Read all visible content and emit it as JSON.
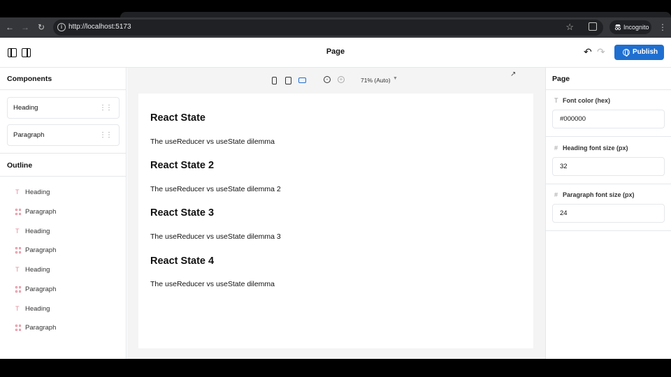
{
  "browser": {
    "url": "http://localhost:5173",
    "profile_label": "Incognito"
  },
  "app": {
    "page_title": "Page",
    "publish_label": "Publish"
  },
  "left_panel": {
    "components_title": "Components",
    "components": [
      {
        "label": "Heading"
      },
      {
        "label": "Paragraph"
      }
    ],
    "outline_title": "Outline",
    "outline": [
      {
        "label": "Heading",
        "icon": "text-icon"
      },
      {
        "label": "Paragraph",
        "icon": "grid-icon"
      },
      {
        "label": "Heading",
        "icon": "text-icon"
      },
      {
        "label": "Paragraph",
        "icon": "grid-icon"
      },
      {
        "label": "Heading",
        "icon": "text-icon"
      },
      {
        "label": "Paragraph",
        "icon": "grid-icon"
      },
      {
        "label": "Heading",
        "icon": "text-icon"
      },
      {
        "label": "Paragraph",
        "icon": "grid-icon"
      }
    ]
  },
  "canvas": {
    "zoom_label": "71% (Auto)",
    "blocks": [
      {
        "heading": "React State",
        "paragraph": "The useReducer vs useState dilemma"
      },
      {
        "heading": "React State 2",
        "paragraph": "The useReducer vs useState dilemma 2"
      },
      {
        "heading": "React State 3",
        "paragraph": "The useReducer vs useState dilemma 3"
      },
      {
        "heading": "React State 4",
        "paragraph": "The useReducer vs useState dilemma"
      }
    ]
  },
  "right_panel": {
    "title": "Page",
    "font_color_label": "Font color (hex)",
    "font_color_value": "#000000",
    "heading_size_label": "Heading font size (px)",
    "heading_size_value": "32",
    "paragraph_size_label": "Paragraph font size (px)",
    "paragraph_size_value": "24"
  },
  "colors": {
    "accent": "#1f6fd0",
    "outline_icon": "#e48c9b"
  }
}
